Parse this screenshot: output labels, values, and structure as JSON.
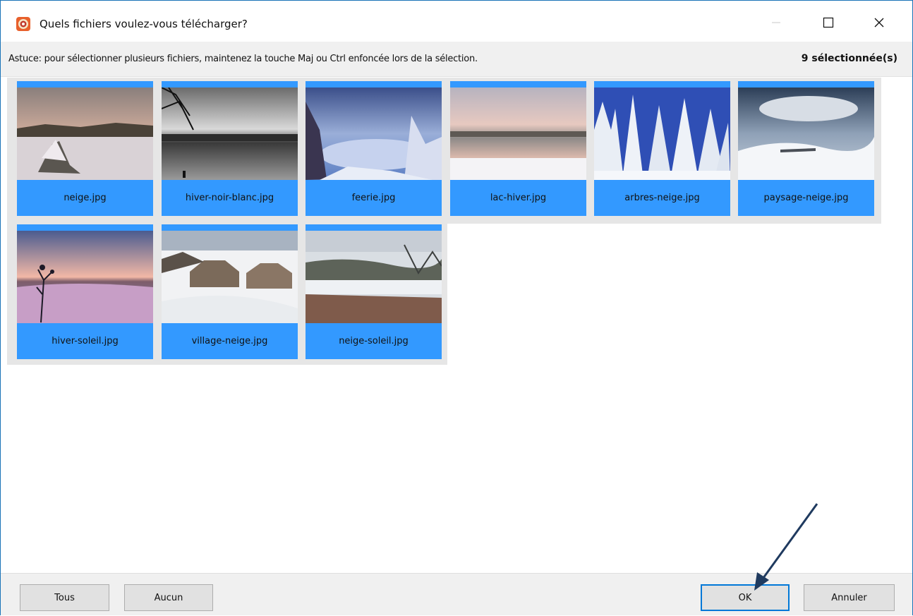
{
  "window": {
    "title": "Quels fichiers voulez-vous télécharger?"
  },
  "hint": {
    "text": "Astuce: pour sélectionner plusieurs fichiers, maintenez la touche Maj ou Ctrl enfoncée lors de la sélection.",
    "selection_count": "9 sélectionnée(s)"
  },
  "files": [
    {
      "name": "neige.jpg"
    },
    {
      "name": "hiver-noir-blanc.jpg"
    },
    {
      "name": "feerie.jpg"
    },
    {
      "name": "lac-hiver.jpg"
    },
    {
      "name": "arbres-neige.jpg"
    },
    {
      "name": "paysage-neige.jpg"
    },
    {
      "name": "hiver-soleil.jpg"
    },
    {
      "name": "village-neige.jpg"
    },
    {
      "name": "neige-soleil.jpg"
    }
  ],
  "footer": {
    "all_label": "Tous",
    "none_label": "Aucun",
    "ok_label": "OK",
    "cancel_label": "Annuler"
  },
  "colors": {
    "selection": "#3399ff",
    "window_border": "#1a73b8",
    "default_button_border": "#0078d7",
    "annotation_arrow": "#1f3a5f"
  },
  "icons": {
    "app": "app-icon",
    "minimize": "minimize-icon",
    "maximize": "maximize-icon",
    "close": "close-icon"
  }
}
